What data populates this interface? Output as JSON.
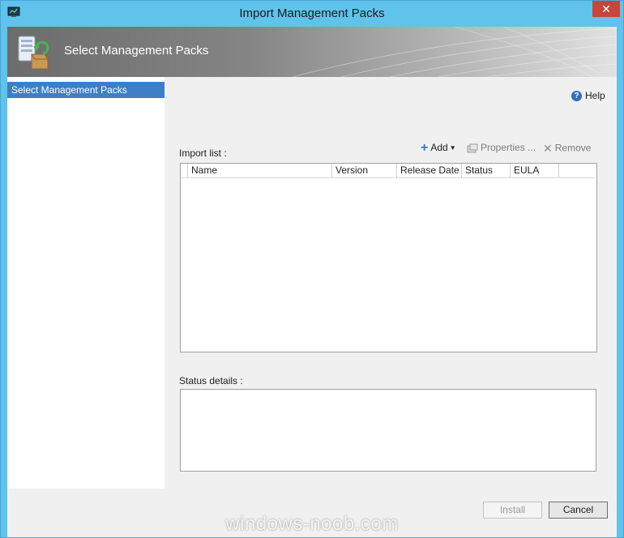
{
  "window": {
    "title": "Import Management Packs",
    "close_glyph": "✕"
  },
  "banner": {
    "title": "Select Management Packs"
  },
  "nav": {
    "items": [
      {
        "label": "Select Management Packs",
        "selected": true
      }
    ]
  },
  "help": {
    "label": "Help",
    "icon": "help-icon"
  },
  "import_list": {
    "label": "Import list :",
    "toolbar": {
      "add": "Add",
      "properties": "Properties ...",
      "remove": "Remove"
    },
    "columns": [
      "Name",
      "Version",
      "Release Date",
      "Status",
      "EULA"
    ],
    "rows": []
  },
  "status_details": {
    "label": "Status details :",
    "value": ""
  },
  "buttons": {
    "install": "Install",
    "cancel": "Cancel"
  },
  "watermark": "windows-noob.com",
  "colors": {
    "titlebar": "#5fc3eb",
    "selection": "#3c7fc7",
    "close": "#c7453d"
  }
}
